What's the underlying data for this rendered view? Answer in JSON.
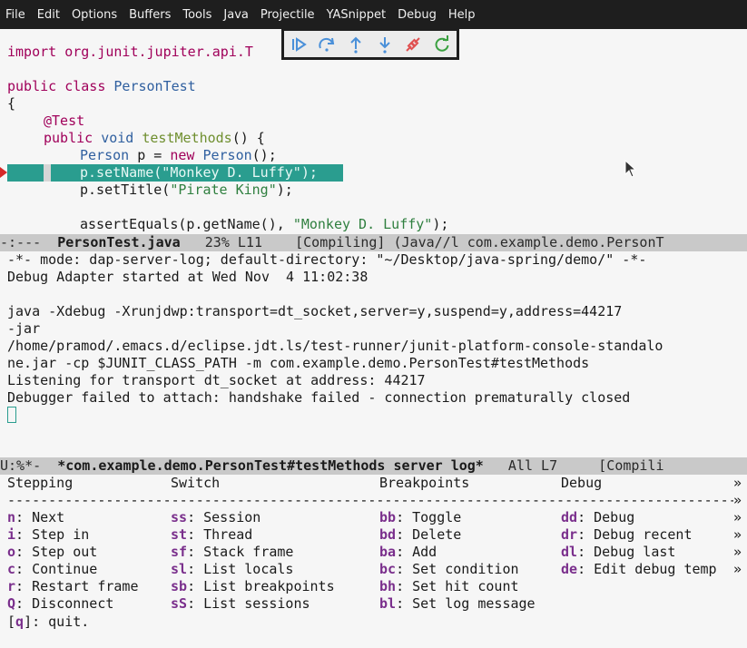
{
  "menu": [
    "File",
    "Edit",
    "Options",
    "Buffers",
    "Tools",
    "Java",
    "Projectile",
    "YASnippet",
    "Debug",
    "Help"
  ],
  "toolbar": {
    "icons": [
      "continue-icon",
      "step-over-icon",
      "step-out-icon",
      "step-in-icon",
      "disconnect-icon",
      "restart-icon"
    ],
    "colors": {
      "blue": "#4a90d9",
      "red": "#e05050",
      "green": "#3aa040"
    }
  },
  "code": {
    "import_kw": "import",
    "import_pkg": " org.junit.jupiter.api.T",
    "public_kw": "public",
    "class_kw": " class ",
    "class_name": "PersonTest",
    "brace_open": "{",
    "annotation": "@Test",
    "method_public": "public",
    "method_void": " void ",
    "method_name": "testMethods",
    "method_rest": "() {",
    "l6_type": "Person",
    "l6_var": " p = ",
    "l6_new": "new",
    "l6_ctor": " Person",
    "l6_end": "();",
    "l7": "p.setName(\"Monkey D. Luffy\");",
    "l8_call": "p.setTitle(",
    "l8_str": "\"Pirate King\"",
    "l8_end": ");",
    "l10_call": "assertEquals(p.getName(), ",
    "l10_str": "\"Monkey D. Luffy\"",
    "l10_end": ");"
  },
  "modeline_top": {
    "prefix": "-:---  ",
    "buffer": "PersonTest.java",
    "pos": "   23% L11    ",
    "modes": "[Compiling] (Java//l com.example.demo.PersonT"
  },
  "log": {
    "header": "-*- mode: dap-server-log; default-directory: \"~/Desktop/java-spring/demo/\" -*-",
    "started": "Debug Adapter started at Wed Nov  4 11:02:38",
    "cmd1": "java -Xdebug -Xrunjdwp:transport=dt_socket,server=y,suspend=y,address=44217",
    "cmd2": "-jar",
    "cmd3": "/home/pramod/.emacs.d/eclipse.jdt.ls/test-runner/junit-platform-console-standalo",
    "cmd4": "ne.jar -cp $JUNIT_CLASS_PATH -m com.example.demo.PersonTest#testMethods",
    "listening": "Listening for transport dt_socket at address: 44217",
    "failed": "Debugger failed to attach: handshake failed - connection prematurally closed"
  },
  "modeline_bottom": {
    "prefix": "U:%*-  ",
    "buffer": "*com.example.demo.PersonTest#testMethods server log*",
    "pos": "   All L7     ",
    "modes": "[Compili"
  },
  "hydra": {
    "headers": [
      "Stepping",
      "Switch",
      "Breakpoints",
      "Debug"
    ],
    "arrow": "»",
    "dashes": "-------------------------------------------------------------------------------------------",
    "col1": [
      [
        "n",
        "Next"
      ],
      [
        "i",
        "Step in"
      ],
      [
        "o",
        "Step out"
      ],
      [
        "c",
        "Continue"
      ],
      [
        "r",
        "Restart frame"
      ],
      [
        "Q",
        "Disconnect"
      ]
    ],
    "col2": [
      [
        "ss",
        "Session"
      ],
      [
        "st",
        "Thread"
      ],
      [
        "sf",
        "Stack frame"
      ],
      [
        "sl",
        "List locals"
      ],
      [
        "sb",
        "List breakpoints"
      ],
      [
        "sS",
        "List sessions"
      ]
    ],
    "col3": [
      [
        "bb",
        "Toggle"
      ],
      [
        "bd",
        "Delete"
      ],
      [
        "ba",
        "Add"
      ],
      [
        "bc",
        "Set condition"
      ],
      [
        "bh",
        "Set hit count"
      ],
      [
        "bl",
        "Set log message"
      ]
    ],
    "col4": [
      [
        "dd",
        "Debug"
      ],
      [
        "dr",
        "Debug recent"
      ],
      [
        "dl",
        "Debug last"
      ],
      [
        "de",
        "Edit debug temp"
      ]
    ],
    "quit_open": "[",
    "quit_key": "q",
    "quit_rest": "]: quit."
  }
}
